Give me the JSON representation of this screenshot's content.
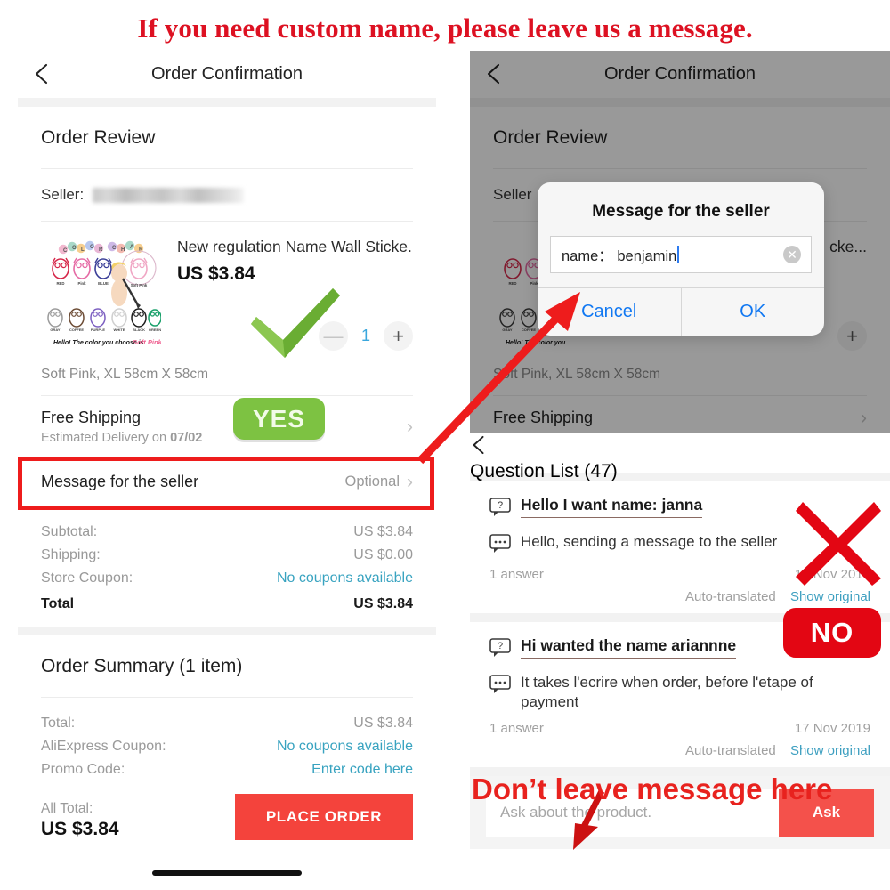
{
  "banner": {
    "text": "If you need custom name, please leave us a message."
  },
  "left_panel": {
    "navbar": {
      "title": "Order Confirmation",
      "back_icon": "chevron-left-icon"
    },
    "section_title": "Order Review",
    "seller_label": "Seller:",
    "product": {
      "name": "New regulation Name Wall Sticke...",
      "price": "US $3.84",
      "variant": "Soft Pink, XL 58cm X 58cm",
      "quantity": "1",
      "minus_label": "—",
      "plus_label": "+",
      "thumb_caption": "Hello! The color you choose is Soft Pink",
      "thumb_heading": "COLOR CHART",
      "thumb_swatch_labels": [
        "RED",
        "Pink",
        "BLUE",
        "Soft Pink",
        "GRAY",
        "COFFEE",
        "PURPLE",
        "WHITE",
        "BLACK",
        "GREEN"
      ]
    },
    "shipping": {
      "label": "Free Shipping",
      "sub_prefix": "Estimated Delivery on ",
      "sub_date": "07/02"
    },
    "message_row": {
      "label": "Message for the seller",
      "value": "Optional"
    },
    "costs": [
      {
        "label": "Subtotal:",
        "value": "US $3.84",
        "link": false
      },
      {
        "label": "Shipping:",
        "value": "US $0.00",
        "link": false
      },
      {
        "label": "Store Coupon:",
        "value": "No coupons available",
        "link": true
      }
    ],
    "total": {
      "label": "Total",
      "value": "US $3.84"
    },
    "order_summary": {
      "title": "Order Summary (1 item)",
      "lines": [
        {
          "label": "Total:",
          "value": "US $3.84",
          "link": false
        },
        {
          "label": "AliExpress Coupon:",
          "value": "No coupons available",
          "link": true
        },
        {
          "label": "Promo Code:",
          "value": "Enter code here",
          "link": true
        }
      ],
      "all_total_label": "All Total:",
      "all_total_value": "US $3.84",
      "place_order": "PLACE ORDER"
    }
  },
  "right_panel": {
    "navbar": {
      "title": "Order Confirmation",
      "back_icon": "chevron-left-icon"
    },
    "section_title": "Order Review",
    "seller_label": "Seller",
    "product_name_tail": "cke...",
    "variant": "Soft Pink, XL 58cm X 58cm",
    "shipping_label": "Free Shipping",
    "dialog": {
      "title": "Message for the seller",
      "input_value": "name： benjamin",
      "clear_icon": "clear-circle-icon",
      "cancel": "Cancel",
      "ok": "OK"
    },
    "question_list": {
      "navbar_title": "Question List (47)",
      "back_icon": "chevron-left-icon",
      "items": [
        {
          "question_icon": "question-bubble-icon",
          "question": "Hello I want name: janna",
          "answer_icon": "answer-bubble-icon",
          "answer": "Hello, sending a message to the seller",
          "answer_count": "1 answer",
          "date": "17 Nov 2019",
          "auto_translated": "Auto-translated",
          "show_original": "Show original"
        },
        {
          "question_icon": "question-bubble-icon",
          "question": "Hi wanted the name ariannne",
          "answer_icon": "answer-bubble-icon",
          "answer": "It takes l'ecrire when order, before l'etape of payment",
          "answer_count": "1 answer",
          "date": "17 Nov 2019",
          "auto_translated": "Auto-translated",
          "show_original": "Show original"
        }
      ],
      "ask_placeholder": "Ask about the product.",
      "ask_button": "Ask"
    }
  },
  "annotations": {
    "yes_badge": "YES",
    "no_badge": "NO",
    "bottom_caption": "Don’t leave  message here",
    "check_icon": "green-check-icon",
    "x_icon": "red-x-icon",
    "arrow_icon": "red-arrow-icon"
  },
  "colors": {
    "banner_red": "#dd1122",
    "annotation_red": "#ee1c1c",
    "no_red": "#e30613",
    "yes_green": "#7dc242",
    "check_green": "#78bd3f",
    "link_teal": "#38a3c0",
    "place_order_red": "#f4433c",
    "dialog_blue": "#1178f2",
    "qty_blue": "#3aa7dd"
  }
}
